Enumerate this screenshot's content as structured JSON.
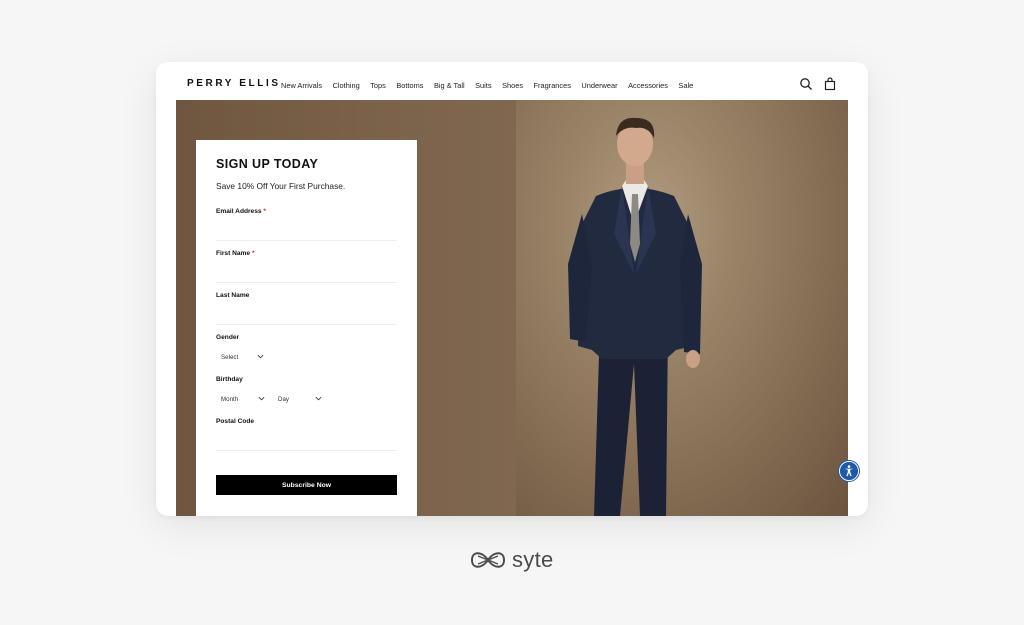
{
  "header": {
    "brand": "PERRY ELLIS",
    "nav": [
      "New Arrivals",
      "Clothing",
      "Tops",
      "Bottoms",
      "Big & Tall",
      "Suits",
      "Shoes",
      "Fragrances",
      "Underwear",
      "Accessories",
      "Sale"
    ],
    "icons": [
      "search-icon",
      "shopping-bag-icon"
    ]
  },
  "signup": {
    "title": "SIGN UP TODAY",
    "subtitle": "Save 10% Off Your First Purchase.",
    "email_label": "Email Address",
    "first_name_label": "First Name",
    "required_mark": "*",
    "last_name_label": "Last Name",
    "gender_label": "Gender",
    "gender_value": "Select",
    "birthday_label": "Birthday",
    "month_value": "Month",
    "day_value": "Day",
    "postal_label": "Postal Code",
    "submit_label": "Subscribe Now"
  },
  "accessibility_icon": "accessibility-icon",
  "footer_logo": {
    "text": "syte"
  },
  "colors": {
    "background": "#f6f6f6",
    "hero_brown": "#7e654c",
    "button": "#000000",
    "accessibility": "#1e5aa8",
    "required": "#c0392b"
  }
}
